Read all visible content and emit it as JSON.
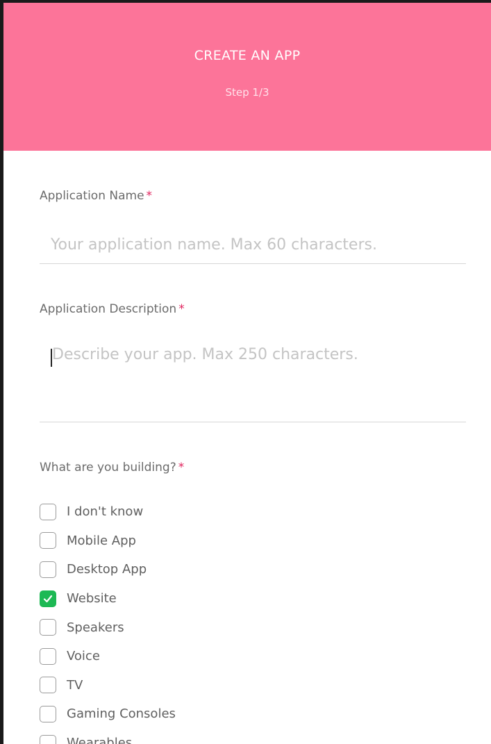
{
  "header": {
    "title": "CREATE AN APP",
    "step": "Step 1/3",
    "background_color": "#fc7499"
  },
  "form": {
    "name_field": {
      "label": "Application Name",
      "required_mark": "*",
      "value": "",
      "placeholder": "Your application name. Max 60 characters."
    },
    "description_field": {
      "label": "Application Description",
      "required_mark": "*",
      "value": "",
      "placeholder": "Describe your app. Max 250 characters."
    },
    "building": {
      "label": "What are you building?",
      "required_mark": "*",
      "options": [
        {
          "label": "I don't know",
          "checked": false
        },
        {
          "label": "Mobile App",
          "checked": false
        },
        {
          "label": "Desktop App",
          "checked": false
        },
        {
          "label": "Website",
          "checked": true
        },
        {
          "label": "Speakers",
          "checked": false
        },
        {
          "label": "Voice",
          "checked": false
        },
        {
          "label": "TV",
          "checked": false
        },
        {
          "label": "Gaming Consoles",
          "checked": false
        },
        {
          "label": "Wearables",
          "checked": false
        }
      ]
    }
  },
  "colors": {
    "accent_check": "#1db954",
    "required_mark": "#e0245e"
  }
}
